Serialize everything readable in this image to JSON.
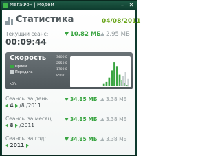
{
  "window": {
    "title": "МегаФон | Модем",
    "minimize_glyph": "–",
    "close_glyph": "✕"
  },
  "header": {
    "title": "Статистика",
    "date": "04/08/2011"
  },
  "current_session": {
    "label": "Текущий сеанс:",
    "time": "00:09:44",
    "downloaded": "10.82 МБ",
    "uploaded": "2.95 МБ"
  },
  "speed": {
    "title": "Скорость",
    "legend_download": "Прием",
    "legend_upload": "Передача",
    "unit": "кб/с",
    "y_ticks": [
      "3400.0",
      "2550.0",
      "1700.0",
      "850.0"
    ],
    "download_levels": [
      0,
      0,
      0,
      0,
      0,
      0,
      0,
      0,
      0,
      0,
      0,
      0,
      0.08,
      0.15,
      0.3,
      0.55,
      0.85,
      0.7,
      0.4,
      0.2,
      0.1,
      0.05
    ],
    "upload_levels": [
      0,
      0,
      0,
      0,
      0,
      0,
      0,
      0,
      0,
      0,
      0,
      0,
      0,
      0,
      0,
      0,
      0,
      0,
      0.15,
      0.35,
      0.5,
      0.25
    ]
  },
  "day": {
    "label": "Сеансы за день:",
    "value": "4",
    "suffix": "/8 /2011",
    "downloaded": "34.85 МБ",
    "uploaded": "3.38 МБ"
  },
  "month": {
    "label": "Сеансы за месяц:",
    "value": "8",
    "suffix": "/2011",
    "downloaded": "34.85 МБ",
    "uploaded": "3.38 МБ"
  },
  "year": {
    "label": "Сеансы за год:",
    "value": "2011",
    "downloaded": "34.85 МБ",
    "uploaded": "3.38 МБ"
  },
  "colors": {
    "accent_green": "#3aa542",
    "date_green": "#6aa51c",
    "upload_grey": "#8e979a",
    "frame": "#0e3a2e"
  },
  "icons": {
    "header": "bar-chart-icon",
    "download": "download-arrow-icon",
    "upload": "upload-arrow-icon"
  }
}
